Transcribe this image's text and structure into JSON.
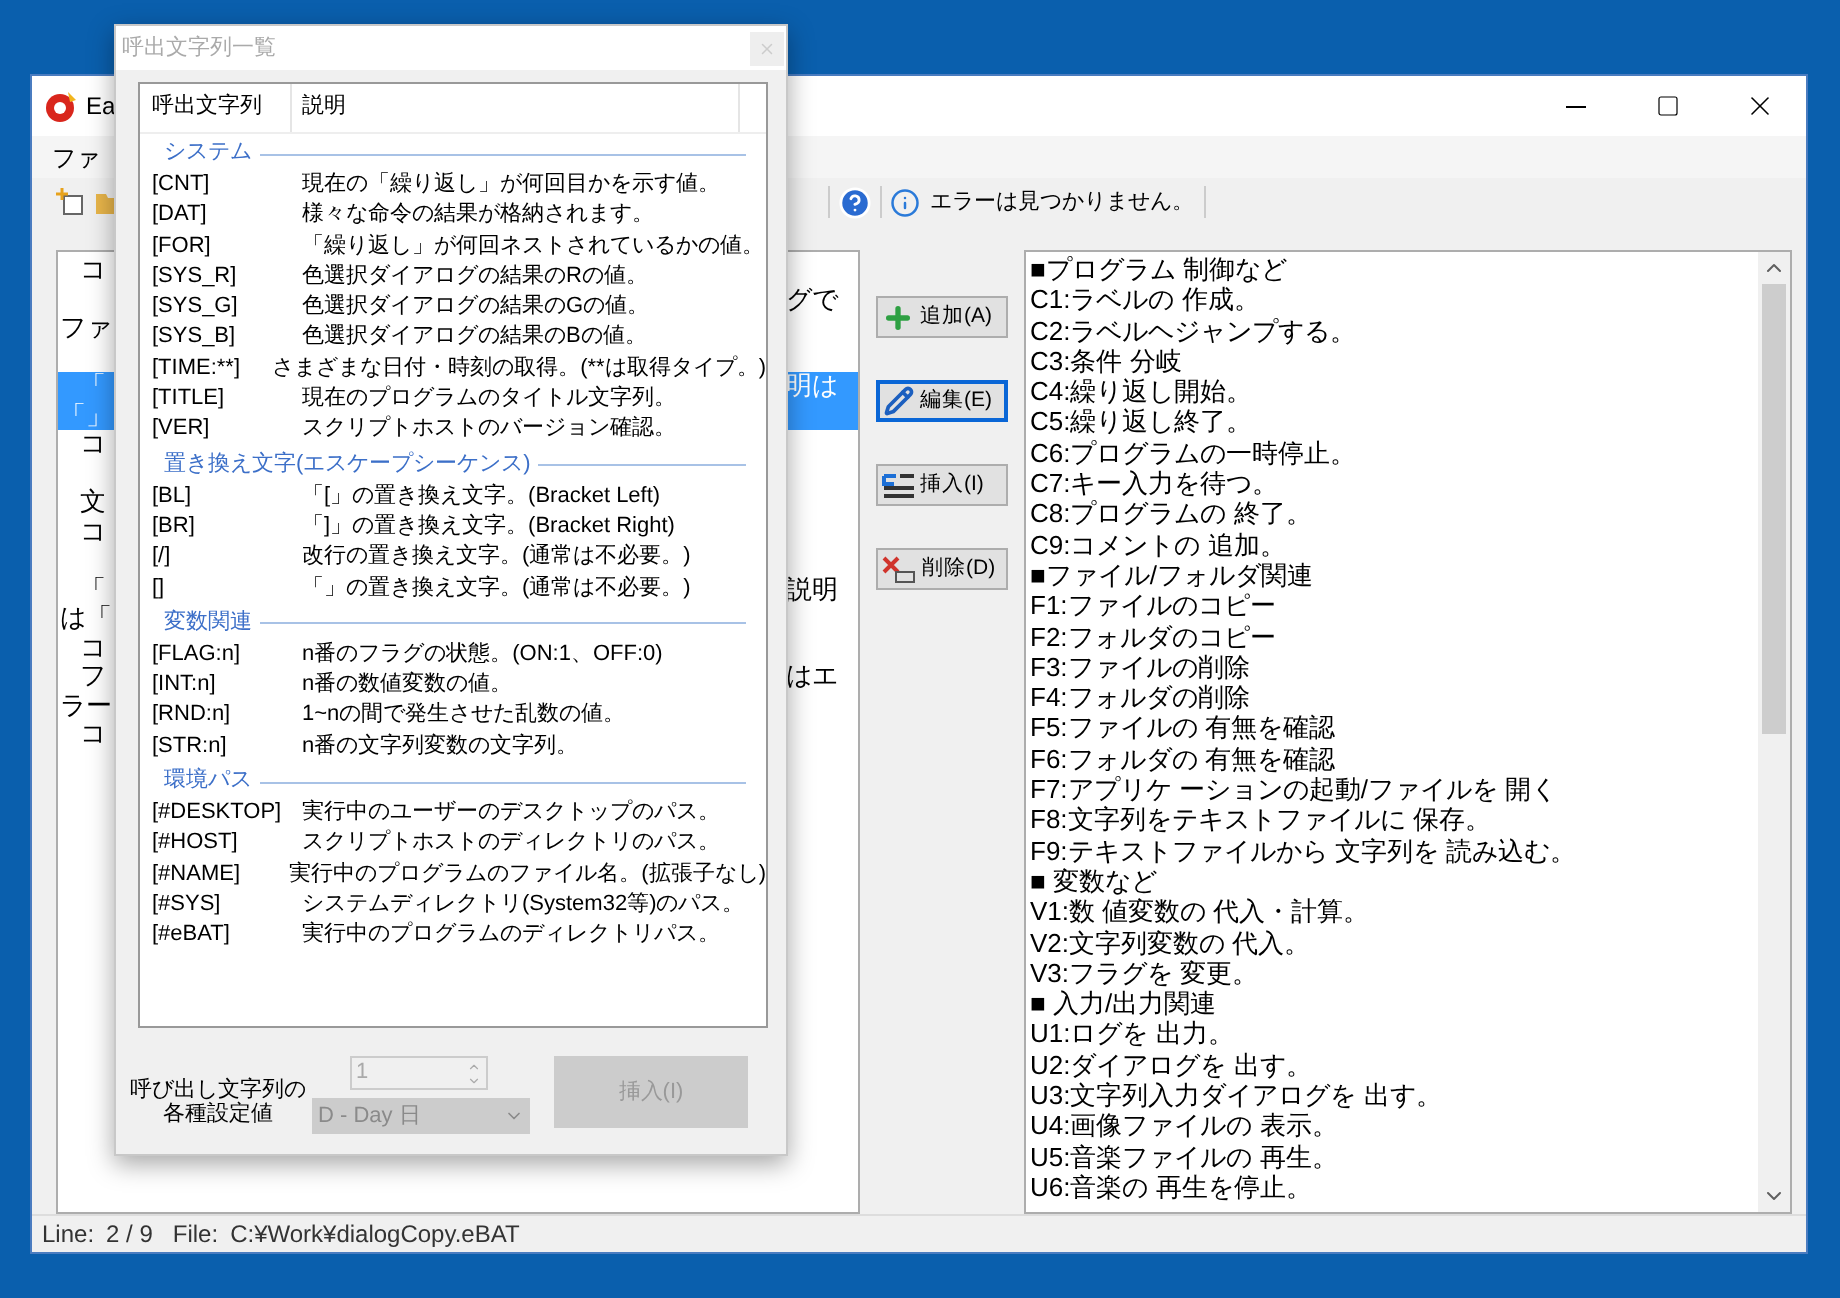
{
  "main_window": {
    "title": "Ea",
    "menu": [
      "ファ"
    ],
    "toolbar_status": "エラーは見つかりません。"
  },
  "editor": {
    "rows": [
      {
        "left": "コ",
        "indent": true,
        "selected": false
      },
      {
        "right": "グで",
        "selected": false
      },
      {
        "left": "ファ",
        "indent": false,
        "selected": false
      },
      {
        "selected": false
      },
      {
        "left": "「",
        "right": "明は",
        "indent": true,
        "selected": true
      },
      {
        "left": "「」",
        "indent": false,
        "selected": true
      },
      {
        "left": "コ",
        "indent": true,
        "selected": false
      },
      {
        "selected": false
      },
      {
        "left": "文",
        "indent": true,
        "selected": false
      },
      {
        "left": "コ",
        "indent": true,
        "selected": false
      },
      {
        "selected": false
      },
      {
        "left": "「",
        "right": "説明",
        "indent": true,
        "selected": false
      },
      {
        "left": "は「",
        "indent": false,
        "selected": false
      },
      {
        "left": "コ",
        "indent": true,
        "selected": false
      },
      {
        "left": "フ",
        "right": "はエ",
        "indent": true,
        "selected": false
      },
      {
        "left": "ラー",
        "indent": false,
        "selected": false
      },
      {
        "left": "コ",
        "indent": true,
        "selected": false
      }
    ]
  },
  "buttons": [
    {
      "label": "追加(A)",
      "kind": "add",
      "focused": false
    },
    {
      "label": "編集(E)",
      "kind": "edit",
      "focused": true
    },
    {
      "label": "挿入(I)",
      "kind": "insert",
      "focused": false
    },
    {
      "label": "削除(D)",
      "kind": "delete",
      "focused": false
    }
  ],
  "command_list": [
    "■プログラム 制御など",
    "C1:ラベルの 作成。",
    "C2:ラベルヘジャンプする。",
    "C3:条件 分岐",
    "C4:繰り返し開始。",
    "C5:繰り返し終了。",
    "C6:プログラムの一時停止。",
    "C7:キー入力を待つ。",
    "C8:プログラムの 終了。",
    "C9:コメントの 追加。",
    "■ファイル/フォルダ関連",
    "F1:ファイルのコピー",
    "F2:フォルダのコピー",
    "F3:ファイルの削除",
    "F4:フォルダの削除",
    "F5:ファイルの 有無を確認",
    "F6:フォルダの 有無を確認",
    "F7:アプリケ ーションの起動/ファイルを 開く",
    "F8:文字列をテキストファイルに 保存。",
    "F9:テキストファイルから 文字列を 読み込む。",
    "■ 変数など",
    "V1:数 値変数の 代入・計算。",
    "V2:文字列変数の 代入。",
    "V3:フラグを 変更。",
    "■ 入力/出力関連",
    "U1:ログを 出力。",
    "U2:ダイアログを 出す。",
    "U3:文字列入力ダイアログを 出す。",
    "U4:画像ファイルの 表示。",
    "U5:音楽ファイルの 再生。",
    "U6:音楽の 再生を停止。"
  ],
  "status_bar": {
    "line_label": "Line:",
    "line": "2 / 9",
    "file_label": "File:",
    "file": "C:¥Work¥dialogCopy.eBAT"
  },
  "dialog": {
    "title": "呼出文字列一覧",
    "columns": [
      "呼出文字列",
      "説明"
    ],
    "groups": [
      {
        "name": "システム",
        "items": [
          [
            "[CNT]",
            "現在の「繰り返し」が何回目かを示す値。"
          ],
          [
            "[DAT]",
            "様々な命令の結果が格納されます。"
          ],
          [
            "[FOR]",
            "「繰り返し」が何回ネストされているかの値。"
          ],
          [
            "[SYS_R]",
            "色選択ダイアログの結果のRの値。"
          ],
          [
            "[SYS_G]",
            "色選択ダイアログの結果のGの値。"
          ],
          [
            "[SYS_B]",
            "色選択ダイアログの結果のBの値。"
          ],
          [
            "[TIME:**]",
            "さまざまな日付・時刻の取得。(**は取得タイプ。)"
          ],
          [
            "[TITLE]",
            "現在のプログラムのタイトル文字列。"
          ],
          [
            "[VER]",
            "スクリプトホストのバージョン確認。"
          ]
        ]
      },
      {
        "name": "置き換え文字(エスケープシーケンス)",
        "items": [
          [
            "[BL]",
            "「[」の置き換え文字。(Bracket Left)"
          ],
          [
            "[BR]",
            "「]」の置き換え文字。(Bracket Right)"
          ],
          [
            "[/]",
            "改行の置き換え文字。(通常は不必要。)"
          ],
          [
            "[]",
            "「」の置き換え文字。(通常は不必要。)"
          ]
        ]
      },
      {
        "name": "変数関連",
        "items": [
          [
            "[FLAG:n]",
            "n番のフラグの状態。(ON:1、OFF:0)"
          ],
          [
            "[INT:n]",
            "n番の数値変数の値。"
          ],
          [
            "[RND:n]",
            "1~nの間で発生させた乱数の値。"
          ],
          [
            "[STR:n]",
            "n番の文字列変数の文字列。"
          ]
        ]
      },
      {
        "name": "環境パス",
        "items": [
          [
            "[#DESKTOP]",
            "実行中のユーザーのデスクトップのパス。"
          ],
          [
            "[#HOST]",
            "スクリプトホストのディレクトリのパス。"
          ],
          [
            "[#NAME]",
            "実行中のプログラムのファイル名。(拡張子なし)"
          ],
          [
            "[#SYS]",
            "システムディレクトリ(System32等)のパス。"
          ],
          [
            "[#eBAT]",
            "実行中のプログラムのディレクトリパス。"
          ]
        ]
      }
    ],
    "settings_label": [
      "呼び出し文字列の",
      "各種設定値"
    ],
    "spin_value": "1",
    "dropdown_value": "D - Day 日",
    "insert_button": "挿入(I)",
    "controls_disabled": true
  }
}
